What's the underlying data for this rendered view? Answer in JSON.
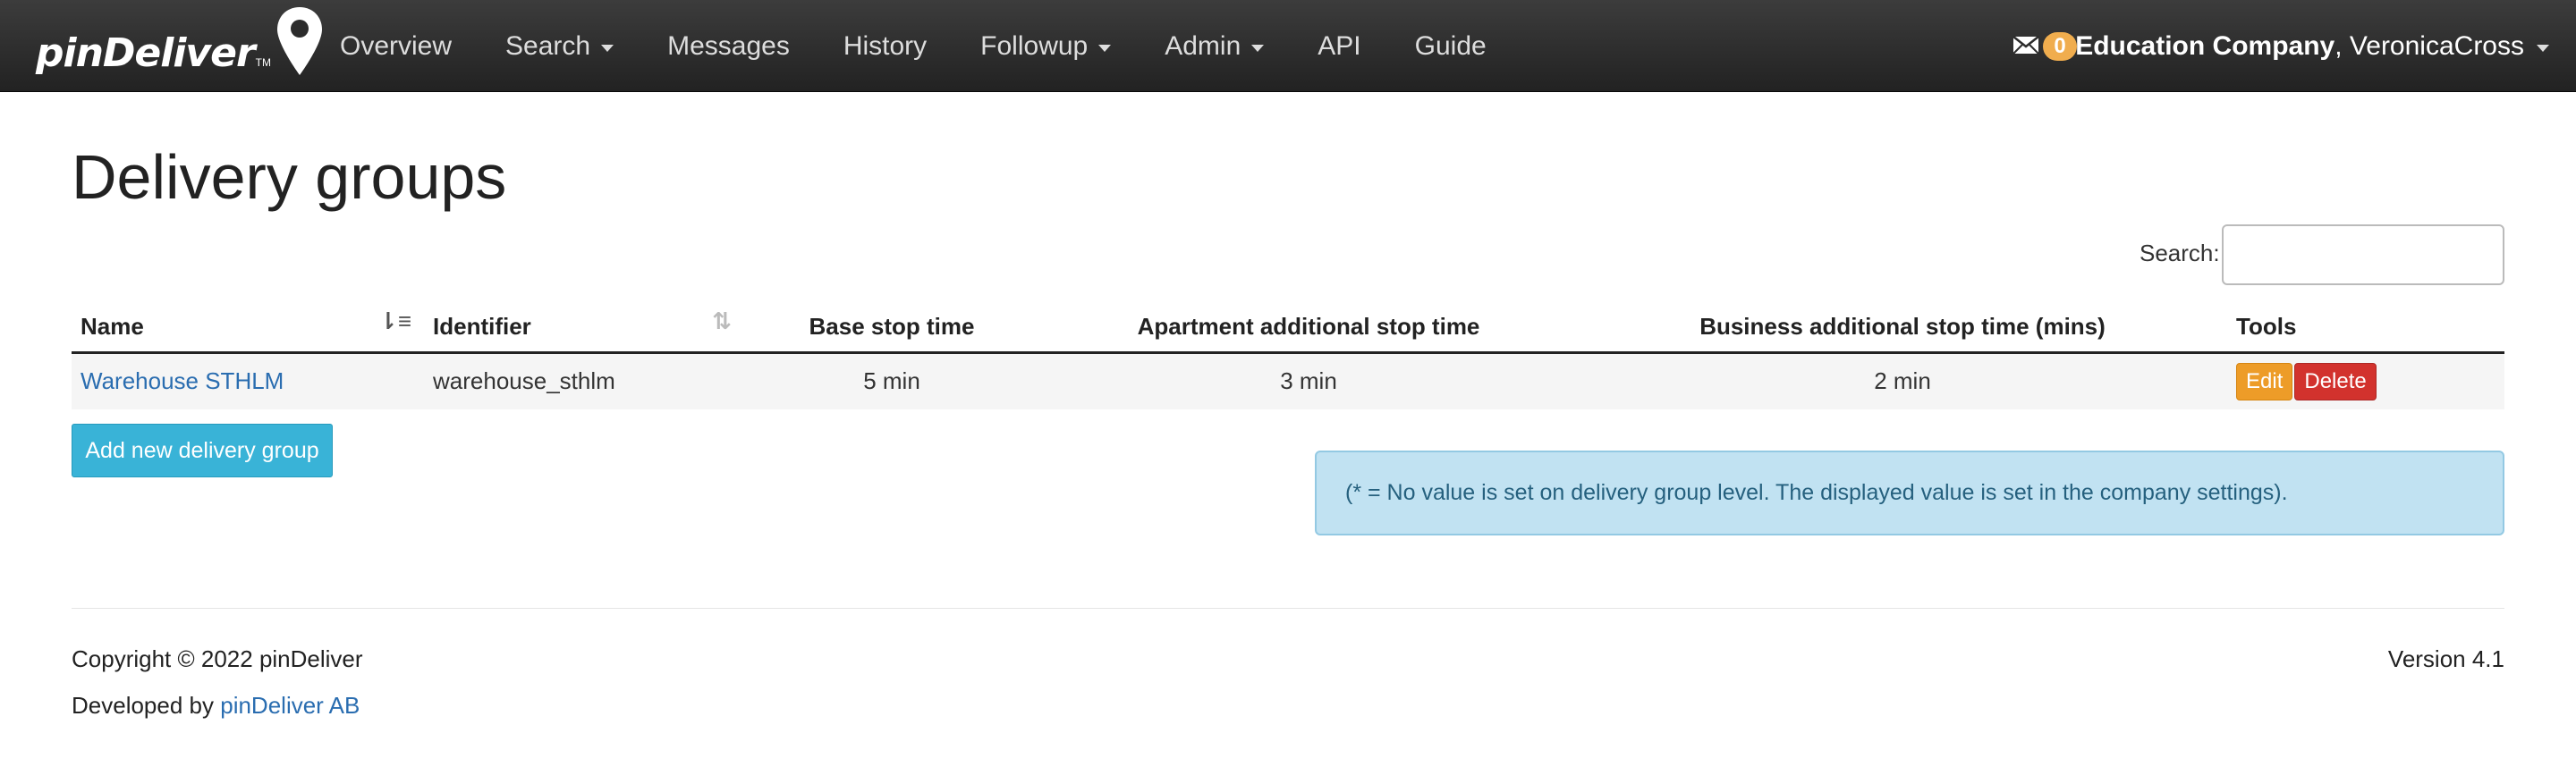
{
  "brand": {
    "name": "pinDeliver",
    "tm": "TM"
  },
  "nav": {
    "items": [
      {
        "label": "Overview",
        "dropdown": false
      },
      {
        "label": "Search",
        "dropdown": true
      },
      {
        "label": "Messages",
        "dropdown": false
      },
      {
        "label": "History",
        "dropdown": false
      },
      {
        "label": "Followup",
        "dropdown": true
      },
      {
        "label": "Admin",
        "dropdown": true
      },
      {
        "label": "API",
        "dropdown": false
      },
      {
        "label": "Guide",
        "dropdown": false
      }
    ],
    "messages_count": "0",
    "company": "Education Company",
    "user": ", VeronicaCross"
  },
  "page": {
    "title": "Delivery groups",
    "search_label": "Search:",
    "search_value": ""
  },
  "table": {
    "headers": [
      "Name",
      "Identifier",
      "Base stop time",
      "Apartment additional stop time",
      "Business additional stop time (mins)",
      "Tools"
    ],
    "rows": [
      {
        "name": "Warehouse STHLM",
        "identifier": "warehouse_sthlm",
        "base": "5 min",
        "apartment": "3 min",
        "business": "2 min"
      }
    ],
    "edit_label": "Edit",
    "delete_label": "Delete"
  },
  "add_button": "Add new delivery group",
  "info": "(* = No value is set on delivery group level. The displayed value is set in the company settings).",
  "footer": {
    "copyright": "Copyright © 2022 pinDeliver",
    "developed_prefix": "Developed by ",
    "developed_link": "pinDeliver AB",
    "version": "Version 4.1"
  },
  "colors": {
    "navbar": "#222222",
    "badge": "#f0ad4e",
    "edit": "#ed9c28",
    "delete": "#d2322d",
    "add": "#39b3d7",
    "info_bg": "#c1e2f2",
    "link": "#2a6db0"
  }
}
